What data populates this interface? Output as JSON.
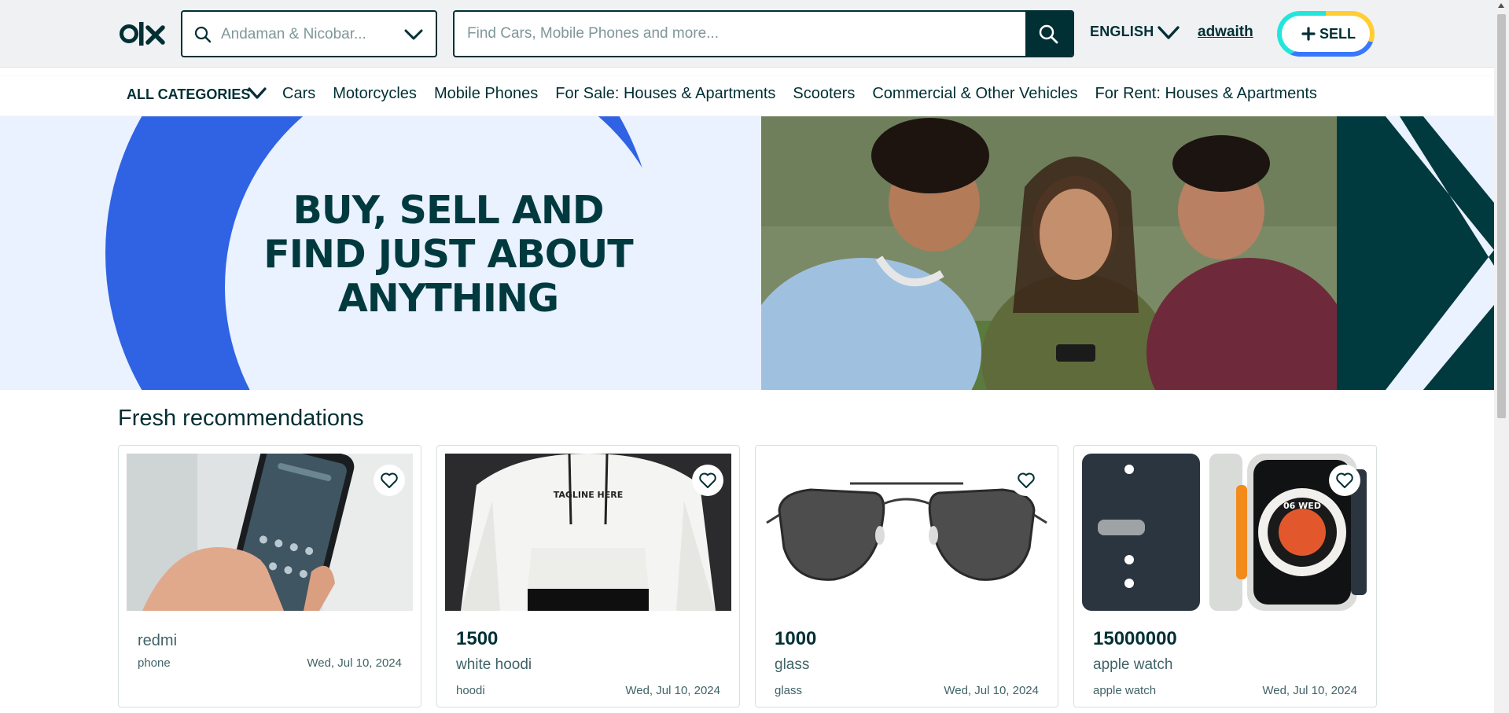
{
  "header": {
    "logo_text": "olx",
    "location": {
      "value": "Andaman & Nicobar...",
      "icon": "search-icon"
    },
    "search": {
      "placeholder": "Find Cars, Mobile Phones and more..."
    },
    "language": "ENGLISH",
    "username": "adwaith",
    "sell_label": "SELL"
  },
  "categories": {
    "all_label": "ALL CATEGORIES",
    "items": [
      "Cars",
      "Motorcycles",
      "Mobile Phones",
      "For Sale: Houses & Apartments",
      "Scooters",
      "Commercial & Other Vehicles",
      "For Rent: Houses & Apartments"
    ]
  },
  "banner": {
    "headline_lines": [
      "BUY, SELL AND",
      "FIND JUST ABOUT",
      "ANYTHING"
    ]
  },
  "recommendations": {
    "title": "Fresh recommendations",
    "cards": [
      {
        "price": "",
        "title": "redmi",
        "category": "phone",
        "date": "Wed, Jul 10, 2024",
        "image": "phone-in-hand"
      },
      {
        "price": "1500",
        "title": "white hoodi",
        "category": "hoodi",
        "date": "Wed, Jul 10, 2024",
        "image": "white-hoodie",
        "image_text": "TAGLINE HERE"
      },
      {
        "price": "1000",
        "title": "glass",
        "category": "glass",
        "date": "Wed, Jul 10, 2024",
        "image": "aviator-sunglasses"
      },
      {
        "price": "15000000",
        "title": "apple watch",
        "category": "apple watch",
        "date": "Wed, Jul 10, 2024",
        "image": "smart-watch",
        "image_text": "06 WED"
      }
    ]
  },
  "colors": {
    "brand_dark": "#002f34",
    "banner_blue": "#2f63e3",
    "banner_light": "#eaf1ff",
    "banner_dark": "#003a3f",
    "sell_ring": [
      "#ffce32",
      "#3a77ff",
      "#23e5db"
    ]
  }
}
